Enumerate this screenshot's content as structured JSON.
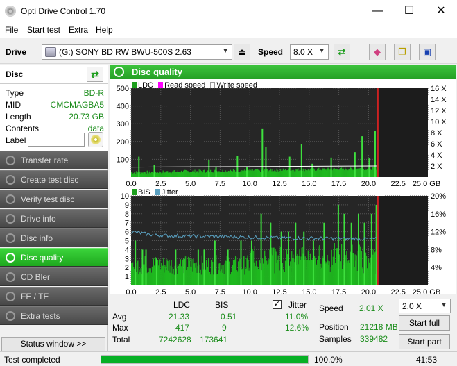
{
  "window": {
    "title": "Opti Drive Control 1.70",
    "minimize": "—",
    "maximize": "☐",
    "close": "✕"
  },
  "menu": [
    "File",
    "Start test",
    "Extra",
    "Help"
  ],
  "toolbar": {
    "drive_label": "Drive",
    "drive_value": "(G:)   SONY BD RW BWU-500S 2.63",
    "speed_label": "Speed",
    "speed_value": "8.0 X"
  },
  "disc": {
    "header": "Disc",
    "rows": [
      {
        "key": "Type",
        "value": "BD-R"
      },
      {
        "key": "MID",
        "value": "CMCMAGBA5"
      },
      {
        "key": "Length",
        "value": "20.73 GB"
      },
      {
        "key": "Contents",
        "value": "data"
      }
    ],
    "label_key": "Label",
    "label_value": ""
  },
  "nav": [
    {
      "label": "Transfer rate",
      "active": false
    },
    {
      "label": "Create test disc",
      "active": false
    },
    {
      "label": "Verify test disc",
      "active": false
    },
    {
      "label": "Drive info",
      "active": false
    },
    {
      "label": "Disc info",
      "active": false
    },
    {
      "label": "Disc quality",
      "active": true
    },
    {
      "label": "CD Bler",
      "active": false
    },
    {
      "label": "FE / TE",
      "active": false
    },
    {
      "label": "Extra tests",
      "active": false
    }
  ],
  "status_window_button": "Status window >>",
  "panel_title": "Disc quality",
  "chart_data": [
    {
      "type": "bar",
      "legend": [
        "LDC",
        "Read speed",
        "Write speed"
      ],
      "x_ticks": [
        "0.0",
        "2.5",
        "5.0",
        "7.5",
        "10.0",
        "12.5",
        "15.0",
        "17.5",
        "20.0",
        "22.5",
        "25.0 GB"
      ],
      "y_ticks_left": [
        "500",
        "400",
        "300",
        "200",
        "100"
      ],
      "y_ticks_right": [
        "16 X",
        "14 X",
        "12 X",
        "10 X",
        "8 X",
        "6 X",
        "4 X",
        "2 X"
      ],
      "xlim": [
        0,
        25
      ],
      "ylim": [
        0,
        500
      ],
      "ylim_right": [
        0,
        16
      ],
      "data_end_gb": 20.73,
      "spikes": [
        [
          0.6,
          115
        ],
        [
          1.9,
          70
        ],
        [
          6.5,
          95
        ],
        [
          7.1,
          60
        ],
        [
          8.9,
          120
        ],
        [
          9.7,
          55
        ],
        [
          11.0,
          270
        ],
        [
          11.3,
          170
        ],
        [
          13.3,
          115
        ],
        [
          14.3,
          185
        ],
        [
          15.2,
          75
        ],
        [
          16.8,
          110
        ],
        [
          18.8,
          140
        ],
        [
          19.4,
          230
        ],
        [
          20.0,
          105
        ],
        [
          20.5,
          260
        ],
        [
          20.7,
          417
        ]
      ],
      "baseline_ldc": [
        [
          0,
          22
        ],
        [
          5,
          25
        ],
        [
          10,
          30
        ],
        [
          15,
          32
        ],
        [
          19,
          38
        ],
        [
          20.73,
          45
        ]
      ],
      "read_speed": [
        [
          0,
          1.8
        ],
        [
          20.73,
          2.0
        ]
      ]
    },
    {
      "type": "bar",
      "legend": [
        "BIS",
        "Jitter"
      ],
      "x_ticks": [
        "0.0",
        "2.5",
        "5.0",
        "7.5",
        "10.0",
        "12.5",
        "15.0",
        "17.5",
        "20.0",
        "22.5",
        "25.0 GB"
      ],
      "y_ticks_left": [
        "10",
        "9",
        "8",
        "7",
        "6",
        "5",
        "4",
        "3",
        "2",
        "1"
      ],
      "y_ticks_right": [
        "20%",
        "16%",
        "12%",
        "8%",
        "4%"
      ],
      "xlim": [
        0,
        25
      ],
      "ylim": [
        0,
        10
      ],
      "ylim_right": [
        0,
        20
      ],
      "data_end_gb": 20.73,
      "bis_spikes": [
        [
          0.3,
          5
        ],
        [
          0.9,
          4
        ],
        [
          1.2,
          4
        ],
        [
          2.1,
          3
        ],
        [
          3.7,
          4
        ],
        [
          4.4,
          3
        ],
        [
          5.6,
          4
        ],
        [
          6.1,
          4
        ],
        [
          7.0,
          5
        ],
        [
          8.1,
          4
        ],
        [
          9.2,
          5
        ],
        [
          10.1,
          5
        ],
        [
          10.9,
          8
        ],
        [
          11.7,
          7
        ],
        [
          12.6,
          6
        ],
        [
          13.2,
          6
        ],
        [
          13.8,
          7
        ],
        [
          14.5,
          6
        ],
        [
          15.3,
          5
        ],
        [
          16.2,
          7
        ],
        [
          17.4,
          9
        ],
        [
          17.9,
          8
        ],
        [
          18.5,
          7
        ],
        [
          19.1,
          8
        ],
        [
          19.6,
          7
        ],
        [
          20.2,
          8
        ],
        [
          20.6,
          9
        ]
      ],
      "jitter": [
        [
          0,
          12.0
        ],
        [
          2,
          11.2
        ],
        [
          5,
          11.0
        ],
        [
          8,
          10.9
        ],
        [
          11,
          10.7
        ],
        [
          14,
          10.6
        ],
        [
          17,
          10.5
        ],
        [
          20.73,
          10.4
        ]
      ]
    }
  ],
  "stats": {
    "col_ldc": "LDC",
    "col_bis": "BIS",
    "jitter_label": "Jitter",
    "jitter_checked": "✓",
    "rows": [
      {
        "label": "Avg",
        "ldc": "21.33",
        "bis": "0.51",
        "jitter": "11.0%"
      },
      {
        "label": "Max",
        "ldc": "417",
        "bis": "9",
        "jitter": "12.6%"
      },
      {
        "label": "Total",
        "ldc": "7242628",
        "bis": "173641"
      }
    ],
    "speed_label": "Speed",
    "speed_value": "2.01 X",
    "speed_select": "2.0 X",
    "position_label": "Position",
    "position_value": "21218 MB",
    "samples_label": "Samples",
    "samples_value": "339482",
    "start_full": "Start full",
    "start_part": "Start part"
  },
  "statusbar": {
    "text": "Test completed",
    "progress": 100,
    "percent": "100.0%",
    "time": "41:53"
  },
  "colors": {
    "ldc": "#1d9e1d",
    "bis": "#1d9e1d",
    "read_speed": "#ff00ff",
    "write_speed": "#ffffff",
    "jitter": "#5aa0c0",
    "marker": "#cc2222"
  }
}
